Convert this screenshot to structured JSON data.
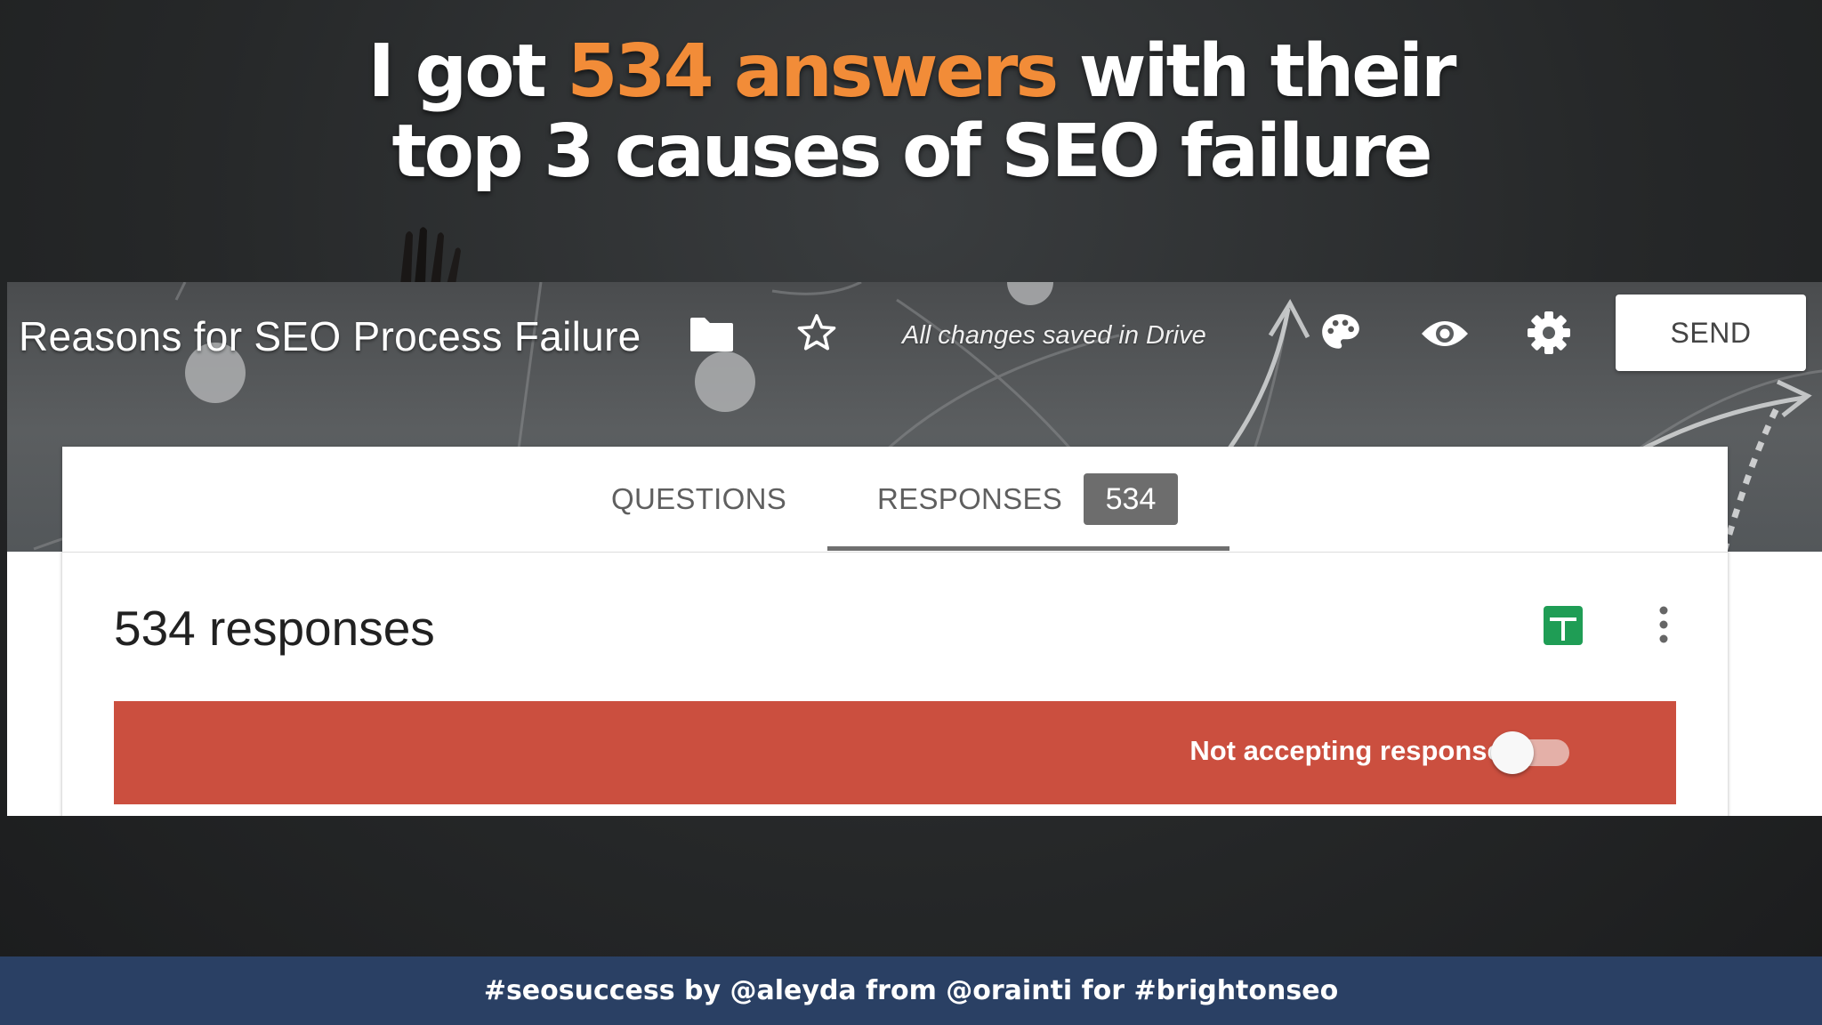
{
  "slide": {
    "headline_pre": "I got ",
    "headline_highlight": "534 answers",
    "headline_post": " with their",
    "headline_line2": "top 3 causes of SEO failure",
    "highlight_color": "#f28c38",
    "footer": "#seosuccess by @aleyda from @orainti for #brightonseo"
  },
  "form": {
    "title": "Reasons for SEO Process Failure",
    "saved_status": "All changes saved in Drive",
    "send_label": "SEND",
    "icons": [
      "folder-icon",
      "star-icon",
      "palette-icon",
      "eye-icon",
      "gear-icon",
      "sheets-icon",
      "more-vert-icon"
    ],
    "tabs": [
      {
        "label": "QUESTIONS",
        "active": false
      },
      {
        "label": "RESPONSES",
        "active": true,
        "badge": "534"
      }
    ],
    "responses_title": "534 responses",
    "accepting_label": "Not accepting responses",
    "accepting_responses": false,
    "accent_color": "#cb4f3f"
  }
}
